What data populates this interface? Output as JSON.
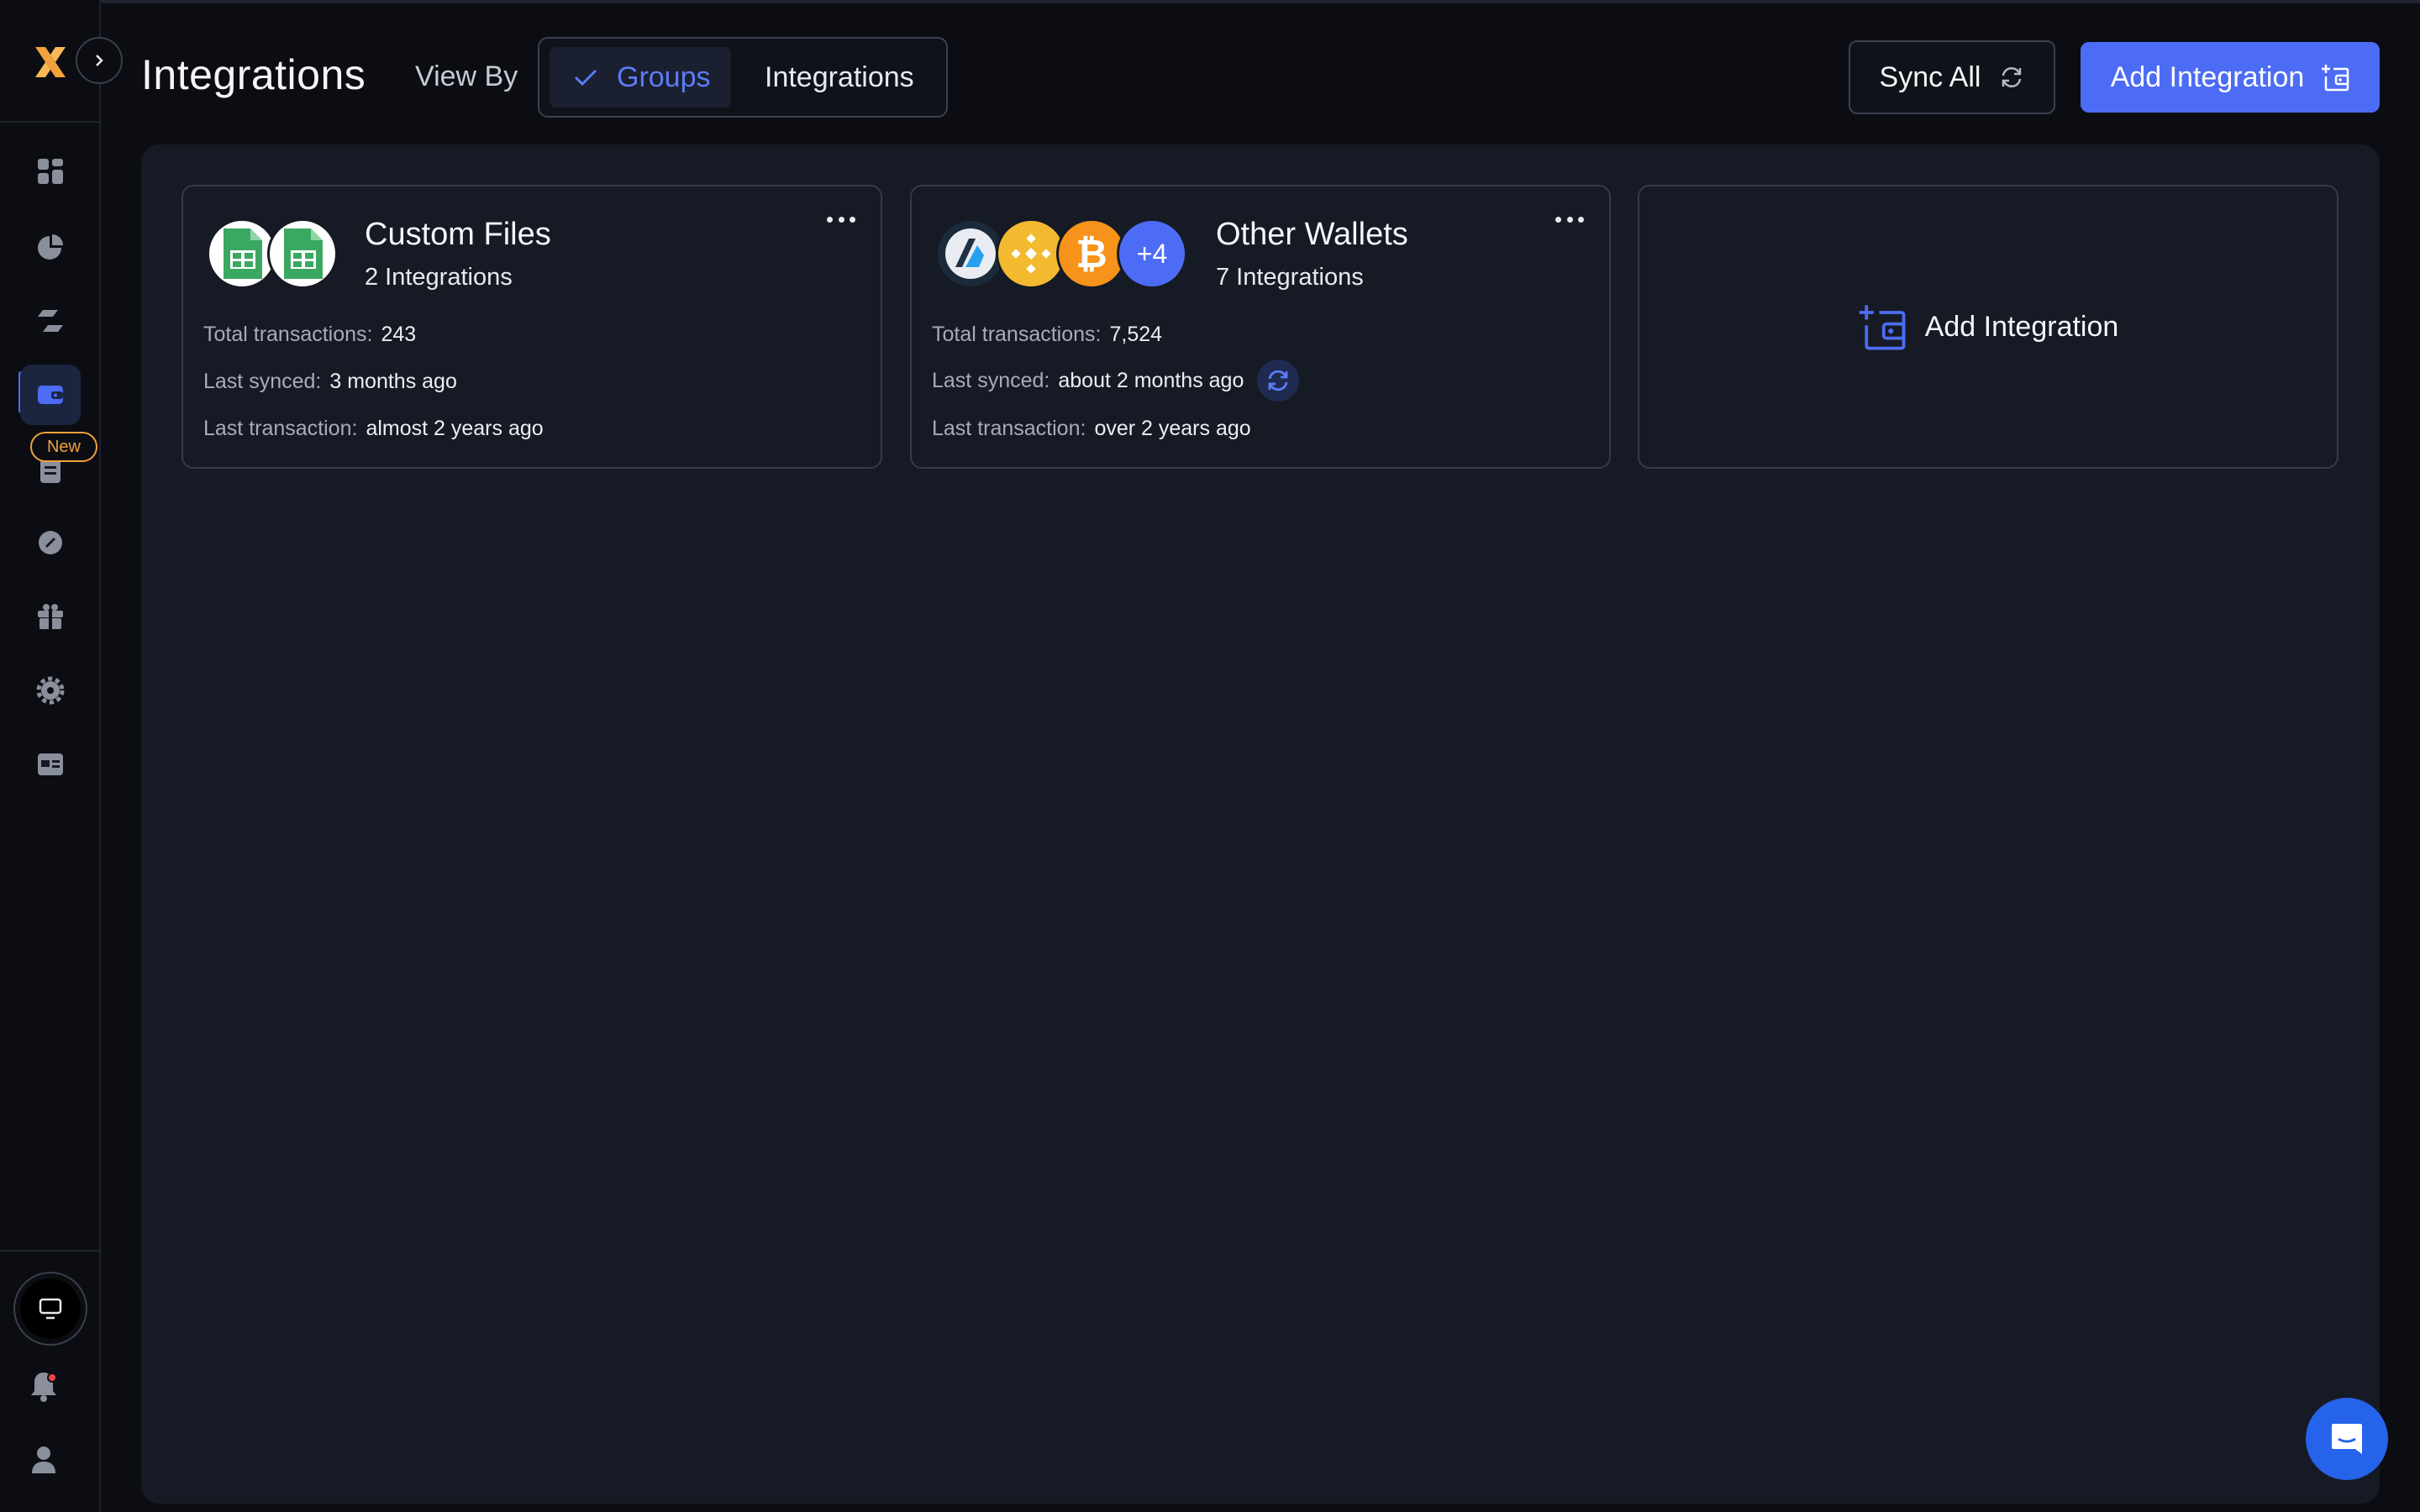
{
  "header": {
    "title": "Integrations",
    "view_by_label": "View By",
    "view_toggle": {
      "groups": "Groups",
      "integrations": "Integrations"
    },
    "sync_all": "Sync All",
    "add_integration": "Add Integration"
  },
  "sidebar": {
    "new_badge": "New",
    "icons": [
      "dashboard-icon",
      "pie-chart-icon",
      "transfer-icon",
      "wallet-icon",
      "document-icon",
      "tag-icon",
      "gift-icon",
      "settings-icon",
      "card-icon"
    ]
  },
  "cards": [
    {
      "title": "Custom Files",
      "subtitle": "2 Integrations",
      "stats": [
        {
          "label": "Total transactions:",
          "value": "243"
        },
        {
          "label": "Last synced:",
          "value": "3 months ago"
        },
        {
          "label": "Last transaction:",
          "value": "almost 2 years ago"
        }
      ]
    },
    {
      "title": "Other Wallets",
      "subtitle": "7 Integrations",
      "extra_count": "+4",
      "stats": [
        {
          "label": "Total transactions:",
          "value": "7,524"
        },
        {
          "label": "Last synced:",
          "value": "about 2 months ago"
        },
        {
          "label": "Last transaction:",
          "value": "over 2 years ago"
        }
      ]
    }
  ],
  "add_card_label": "Add Integration",
  "colors": {
    "accent": "#4d6cf5",
    "badge": "#f0a23c",
    "sheets": "#3aa860",
    "binance": "#f3ba2f",
    "bitcoin": "#f7931a"
  }
}
